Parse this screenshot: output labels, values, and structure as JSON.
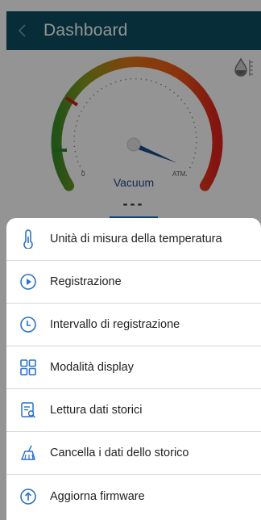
{
  "app": {
    "title": "Dashboard"
  },
  "gauge": {
    "label": "Vacuum",
    "scale_start": "0",
    "scale_end": "ATM.",
    "value_display": "---"
  },
  "menu": {
    "items": [
      {
        "label": "Unità di misura della temperatura",
        "icon": "thermometer-icon"
      },
      {
        "label": "Registrazione",
        "icon": "play-circle-icon"
      },
      {
        "label": "Intervallo di registrazione",
        "icon": "clock-icon"
      },
      {
        "label": "Modalità display",
        "icon": "grid-icon"
      },
      {
        "label": "Lettura dati storici",
        "icon": "history-search-icon"
      },
      {
        "label": "Cancella i dati dello storico",
        "icon": "broom-icon"
      },
      {
        "label": "Aggiorna firmware",
        "icon": "upload-circle-icon"
      }
    ]
  },
  "colors": {
    "appbar": "#0d4f63",
    "accent_blue": "#2a72c8",
    "gauge_green": "#3c8d2a",
    "gauge_orange": "#e07418",
    "gauge_red": "#e0231e",
    "needle": "#1a4d8f"
  }
}
